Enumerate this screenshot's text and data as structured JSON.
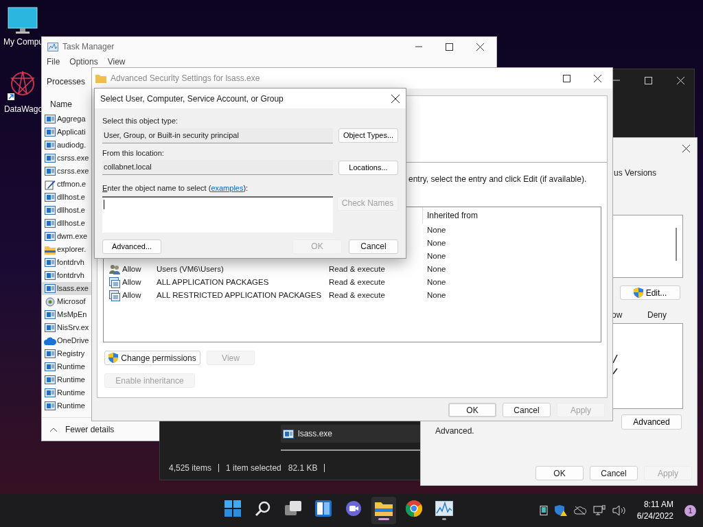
{
  "desktop_icons": [
    {
      "label": "My Compu",
      "kind": "computer"
    },
    {
      "label": "DataWago",
      "kind": "shortcut"
    }
  ],
  "explorer_window": {
    "item": "lsass.exe",
    "status": [
      "4,525 items",
      "1 item selected",
      "82.1 KB"
    ]
  },
  "properties_window": {
    "tab": "us Versions",
    "edit_button": "Edit...",
    "permission_columns": [
      "ow",
      "Deny"
    ],
    "note": "Advanced.",
    "advanced_button": "Advanced",
    "buttons": [
      {
        "label": "OK",
        "disabled": false
      },
      {
        "label": "Cancel",
        "disabled": false
      },
      {
        "label": "Apply",
        "disabled": true
      }
    ]
  },
  "task_manager": {
    "title": "Task Manager",
    "menu": [
      "File",
      "Options",
      "View"
    ],
    "tab": "Processes",
    "column": "Name",
    "processes": [
      {
        "name": "Aggrega",
        "kind": "app",
        "selected": false
      },
      {
        "name": "Applicati",
        "kind": "app",
        "selected": false
      },
      {
        "name": "audiodg.",
        "kind": "app",
        "selected": false
      },
      {
        "name": "csrss.exe",
        "kind": "app",
        "selected": false
      },
      {
        "name": "csrss.exe",
        "kind": "app",
        "selected": false
      },
      {
        "name": "ctfmon.e",
        "kind": "pen",
        "selected": false
      },
      {
        "name": "dllhost.e",
        "kind": "app",
        "selected": false
      },
      {
        "name": "dllhost.e",
        "kind": "app",
        "selected": false
      },
      {
        "name": "dllhost.e",
        "kind": "app",
        "selected": false
      },
      {
        "name": "dwm.exe",
        "kind": "app",
        "selected": false
      },
      {
        "name": "explorer.",
        "kind": "folder",
        "selected": false
      },
      {
        "name": "fontdrvh",
        "kind": "app",
        "selected": false
      },
      {
        "name": "fontdrvh",
        "kind": "app",
        "selected": false
      },
      {
        "name": "lsass.exe",
        "kind": "app",
        "selected": true
      },
      {
        "name": "Microsof",
        "kind": "service",
        "selected": false
      },
      {
        "name": "MsMpEn",
        "kind": "app",
        "selected": false
      },
      {
        "name": "NisSrv.ex",
        "kind": "app",
        "selected": false
      },
      {
        "name": "OneDrive",
        "kind": "cloud",
        "selected": false
      },
      {
        "name": "Registry",
        "kind": "app",
        "selected": false
      },
      {
        "name": "Runtime",
        "kind": "app",
        "selected": false
      },
      {
        "name": "Runtime",
        "kind": "app",
        "selected": false
      },
      {
        "name": "Runtime",
        "kind": "app",
        "selected": false
      },
      {
        "name": "Runtime",
        "kind": "app",
        "selected": false
      }
    ],
    "footer": "Fewer details"
  },
  "advanced_security": {
    "title": "Advanced Security Settings for lsass.exe",
    "instruction": "entry, select the entry and click Edit (if available).",
    "column": "Inherited from",
    "entries": [
      {
        "inherited_from": "None"
      },
      {
        "inherited_from": "None"
      },
      {
        "inherited_from": "None"
      },
      {
        "kind": "users",
        "type": "Allow",
        "principal": "Users (VM6\\Users)",
        "access": "Read & execute",
        "inherited_from": "None"
      },
      {
        "kind": "package",
        "type": "Allow",
        "principal": "ALL APPLICATION PACKAGES",
        "access": "Read & execute",
        "inherited_from": "None"
      },
      {
        "kind": "package",
        "type": "Allow",
        "principal": "ALL RESTRICTED APPLICATION PACKAGES",
        "access": "Read & execute",
        "inherited_from": "None"
      }
    ],
    "actions": [
      {
        "label": "Change permissions",
        "disabled": false,
        "shield": true
      },
      {
        "label": "View",
        "disabled": true,
        "shield": false
      },
      {
        "label": "Enable inheritance",
        "disabled": true,
        "shield": false
      }
    ],
    "buttons": [
      {
        "label": "OK",
        "disabled": false,
        "default": true
      },
      {
        "label": "Cancel",
        "disabled": false,
        "default": false
      },
      {
        "label": "Apply",
        "disabled": true,
        "default": false
      }
    ]
  },
  "select_dialog": {
    "title": "Select User, Computer, Service Account, or Group",
    "object_type_label": "Select this object type:",
    "object_type": "User, Group, or Built-in security principal",
    "object_types_button": "Object Types...",
    "location_label": "From this location:",
    "location": "collabnet.local",
    "locations_button": "Locations...",
    "name_label_start": "nter the object name to select (",
    "name_label_accel": "E",
    "examples_link": "examples",
    "name_label_end": "):",
    "check_names": {
      "label": "Check Names",
      "disabled": true
    },
    "advanced_button": "Advanced...",
    "buttons": [
      {
        "label": "OK",
        "disabled": true
      },
      {
        "label": "Cancel",
        "disabled": false
      }
    ]
  },
  "taskbar": {
    "apps": [
      {
        "kind": "start",
        "active": false,
        "running": false
      },
      {
        "kind": "search",
        "active": false,
        "running": false
      },
      {
        "kind": "taskview",
        "active": false,
        "running": false
      },
      {
        "kind": "widgets",
        "active": false,
        "running": false
      },
      {
        "kind": "chat",
        "active": false,
        "running": false
      },
      {
        "kind": "explorer",
        "active": true,
        "running": true
      },
      {
        "kind": "chrome",
        "active": false,
        "running": false
      },
      {
        "kind": "taskmanager",
        "active": false,
        "running": true
      }
    ],
    "time": "8:11 AM",
    "date": "6/24/2022",
    "notifications": "1"
  }
}
